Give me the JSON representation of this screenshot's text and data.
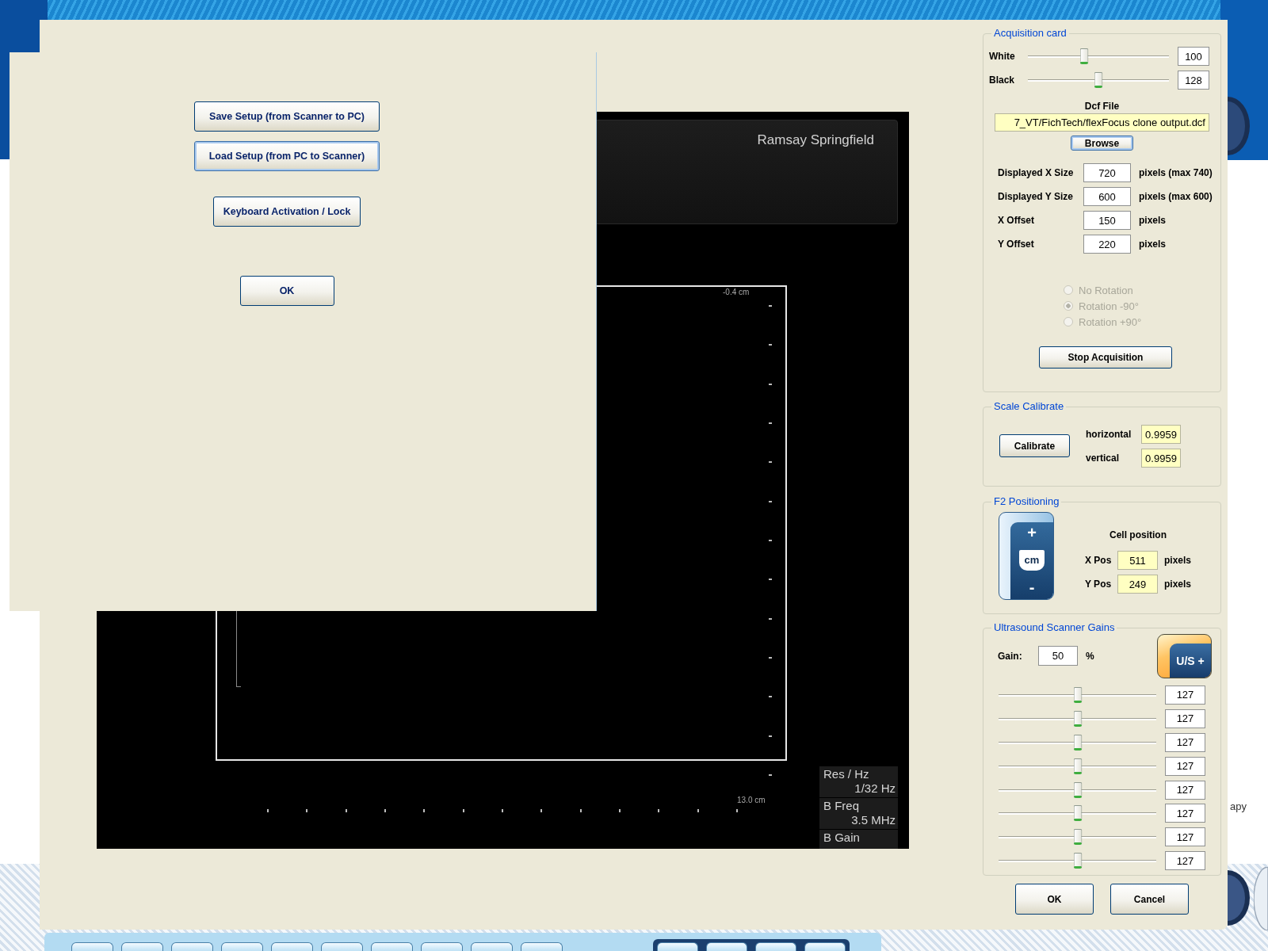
{
  "background_window": {
    "text": "apy"
  },
  "setup_dialog": {
    "buttons": [
      {
        "label": "Save Setup (from Scanner to PC)",
        "focused": false
      },
      {
        "label": "Load Setup (from PC to Scanner)",
        "focused": true
      },
      {
        "label": "Keyboard Activation / Lock",
        "focused": false
      },
      {
        "label": "OK",
        "focused": false
      }
    ]
  },
  "scan_view": {
    "header": "Ramsay Springfield",
    "depth_top": "-0.4 cm",
    "depth_bottom": "13.0 cm",
    "readouts": [
      {
        "label": "Res / Hz",
        "value": "1/32 Hz"
      },
      {
        "label": "B Freq",
        "value": "3.5 MHz"
      },
      {
        "label": "B Gain"
      }
    ]
  },
  "acquisition_card": {
    "title": "Acquisition card",
    "levels": [
      {
        "label": "White",
        "level": 0.4,
        "value": "100"
      },
      {
        "label": "Black",
        "level": 0.5,
        "value": "128"
      }
    ],
    "dcf_file": {
      "label": "Dcf File",
      "value": "7_VT/FichTech/flexFocus clone output.dcf"
    },
    "browse_button": "Browse",
    "size_fields": [
      {
        "label": "Displayed X Size",
        "value": "720",
        "unit": "pixels (max 740)"
      },
      {
        "label": "Displayed Y Size",
        "value": "600",
        "unit": "pixels (max 600)"
      },
      {
        "label": "X Offset",
        "value": "150",
        "unit": "pixels"
      },
      {
        "label": "Y Offset",
        "value": "220",
        "unit": "pixels"
      }
    ],
    "rotation": {
      "disabled": true,
      "options": [
        {
          "label": "No Rotation",
          "selected": false
        },
        {
          "label": "Rotation -90°",
          "selected": true
        },
        {
          "label": "Rotation +90°",
          "selected": false
        }
      ]
    },
    "stop_button": "Stop Acquisition"
  },
  "scale_calibrate": {
    "title": "Scale Calibrate",
    "button": "Calibrate",
    "fields": [
      {
        "label": "horizontal",
        "value": "0.9959"
      },
      {
        "label": "vertical",
        "value": "0.9959"
      }
    ]
  },
  "f2_positioning": {
    "title": "F2 Positioning",
    "depth_button": {
      "top": "+",
      "middle": "cm",
      "bottom": "-"
    },
    "cell_position": {
      "title": "Cell position",
      "fields": [
        {
          "label": "X Pos",
          "value": "511",
          "unit": "pixels"
        },
        {
          "label": "Y Pos",
          "value": "249",
          "unit": "pixels"
        }
      ]
    }
  },
  "scanner_gains": {
    "title": "Ultrasound Scanner Gains",
    "gain": {
      "label": "Gain:",
      "value": "50",
      "unit": "%"
    },
    "us_button": "U/S +",
    "sliders": [
      {
        "level": 0.5,
        "value": "127"
      },
      {
        "level": 0.5,
        "value": "127"
      },
      {
        "level": 0.5,
        "value": "127"
      },
      {
        "level": 0.5,
        "value": "127"
      },
      {
        "level": 0.5,
        "value": "127"
      },
      {
        "level": 0.5,
        "value": "127"
      },
      {
        "level": 0.5,
        "value": "127"
      },
      {
        "level": 0.5,
        "value": "127"
      }
    ]
  },
  "dialog_buttons": [
    "OK",
    "Cancel"
  ]
}
